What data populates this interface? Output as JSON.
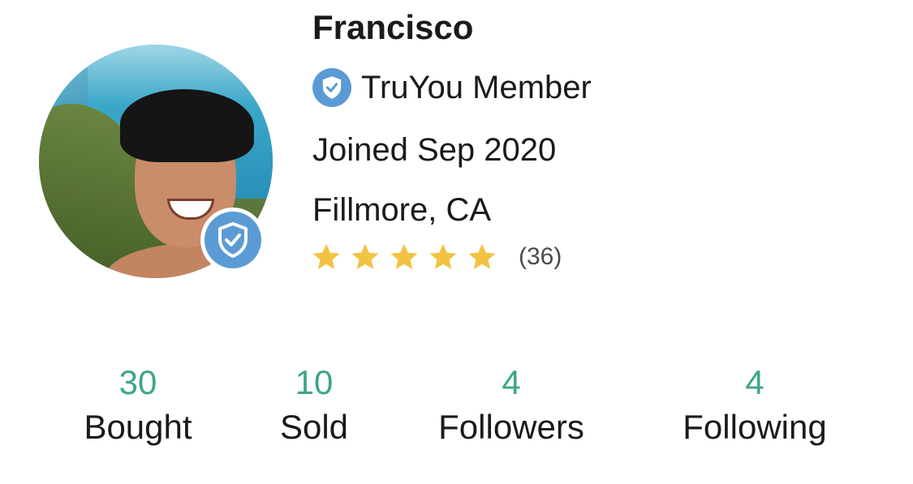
{
  "profile": {
    "name": "Francisco",
    "member_label": "TruYou Member",
    "joined": "Joined Sep 2020",
    "location": "Fillmore, CA",
    "rating": {
      "stars": 5,
      "max_stars": 5,
      "count_label": "(36)"
    },
    "avatar_icon": "profile-photo",
    "verified_icon": "shield-check-icon"
  },
  "stats": {
    "bought": {
      "value": "30",
      "label": "Bought"
    },
    "sold": {
      "value": "10",
      "label": "Sold"
    },
    "followers": {
      "value": "4",
      "label": "Followers"
    },
    "following": {
      "value": "4",
      "label": "Following"
    }
  },
  "colors": {
    "accent_blue": "#5b9bd5",
    "stat_green": "#3fa58a",
    "star_gold": "#f2c343",
    "text": "#1a1a1a"
  }
}
